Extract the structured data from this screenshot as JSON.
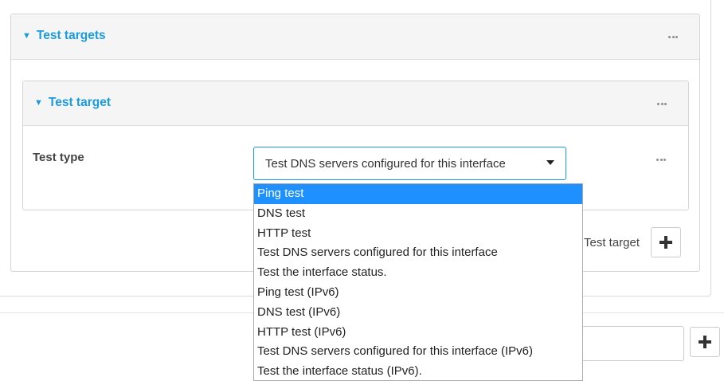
{
  "test_targets_panel": {
    "title": "Test targets",
    "menu_icon": "more-dots-icon"
  },
  "test_target_panel": {
    "title": "Test target",
    "menu_icon": "more-dots-icon"
  },
  "test_type": {
    "label": "Test type",
    "selected_value": "Test DNS servers configured for this interface",
    "field_menu_icon": "more-dots-icon"
  },
  "dropdown": {
    "highlighted": "Ping test",
    "options": [
      "Ping test",
      "DNS test",
      "HTTP test",
      "Test DNS servers configured for this interface",
      "Test the interface status.",
      "Ping test (IPv6)",
      "DNS test (IPv6)",
      "HTTP test (IPv6)",
      "Test DNS servers configured for this interface (IPv6)",
      "Test the interface status (IPv6)."
    ]
  },
  "add_test_target": {
    "label": "Test target",
    "icon": "plus-icon"
  },
  "add_item": {
    "icon": "plus-icon"
  },
  "colors": {
    "accent": "#1a9be0",
    "highlight": "#1e90ff",
    "header_bg": "#f5f5f5"
  }
}
